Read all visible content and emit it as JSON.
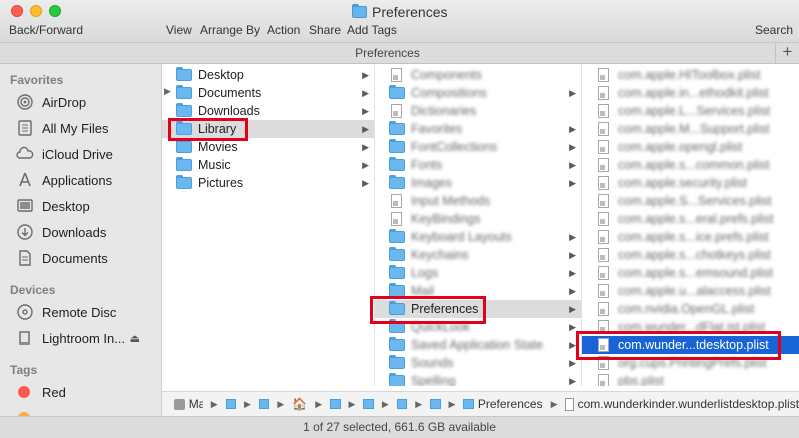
{
  "window": {
    "title": "Preferences"
  },
  "toolbar": {
    "back_forward": "Back/Forward",
    "view": "View",
    "arrange_by": "Arrange By",
    "action": "Action",
    "share": "Share",
    "add_tags": "Add Tags",
    "search": "Search"
  },
  "path_header": {
    "title": "Preferences",
    "plus": "+"
  },
  "sidebar": {
    "favorites_heading": "Favorites",
    "favorites": [
      {
        "label": "AirDrop",
        "icon": "airdrop-icon"
      },
      {
        "label": "All My Files",
        "icon": "all-files-icon"
      },
      {
        "label": "iCloud Drive",
        "icon": "cloud-icon"
      },
      {
        "label": "Applications",
        "icon": "applications-icon"
      },
      {
        "label": "Desktop",
        "icon": "desktop-icon"
      },
      {
        "label": "Downloads",
        "icon": "downloads-icon"
      },
      {
        "label": "Documents",
        "icon": "documents-icon"
      }
    ],
    "devices_heading": "Devices",
    "devices": [
      {
        "label": "Remote Disc",
        "icon": "disc-icon"
      },
      {
        "label": "Lightroom In...",
        "icon": "drive-icon"
      }
    ],
    "tags_heading": "Tags",
    "tags": [
      {
        "label": "Red",
        "color": "#fc5753"
      }
    ]
  },
  "column1": {
    "items": [
      {
        "label": "Desktop"
      },
      {
        "label": "Documents"
      },
      {
        "label": "Downloads"
      },
      {
        "label": "Library"
      },
      {
        "label": "Movies"
      },
      {
        "label": "Music"
      },
      {
        "label": "Pictures"
      }
    ]
  },
  "column2": {
    "items": [
      {
        "label": "Components"
      },
      {
        "label": "Compositions"
      },
      {
        "label": "Dictionaries"
      },
      {
        "label": "Favorites"
      },
      {
        "label": "FontCollections"
      },
      {
        "label": "Fonts"
      },
      {
        "label": "Images"
      },
      {
        "label": "Input Methods"
      },
      {
        "label": "KeyBindings"
      },
      {
        "label": "Keyboard Layouts"
      },
      {
        "label": "Keychains"
      },
      {
        "label": "Logs"
      },
      {
        "label": "Mail"
      },
      {
        "label": "Preferences"
      },
      {
        "label": "QuickLook"
      },
      {
        "label": "Saved Application State"
      },
      {
        "label": "Sounds"
      },
      {
        "label": "Spelling"
      }
    ]
  },
  "column3": {
    "items": [
      {
        "label": "com.apple.HIToolbox.plist"
      },
      {
        "label": "com.apple.in...ethodkit.plist"
      },
      {
        "label": "com.apple.L...Services.plist"
      },
      {
        "label": "com.apple.M...Support.plist"
      },
      {
        "label": "com.apple.opengl.plist"
      },
      {
        "label": "com.apple.s...common.plist"
      },
      {
        "label": "com.apple.security.plist"
      },
      {
        "label": "com.apple.S...Services.plist"
      },
      {
        "label": "com.apple.s...eral.prefs.plist"
      },
      {
        "label": "com.apple.s...ice.prefs.plist"
      },
      {
        "label": "com.apple.s...chotkeys.plist"
      },
      {
        "label": "com.apple.s...emsound.plist"
      },
      {
        "label": "com.apple.u...alaccess.plist"
      },
      {
        "label": "com.nvidia.OpenGL.plist"
      },
      {
        "label": "com.wunder...dFlat.ist.plist"
      },
      {
        "label": "com.wunder...tdesktop.plist"
      },
      {
        "label": "org.cups.PrintingPrefs.plist"
      },
      {
        "label": "pbs.plist"
      }
    ]
  },
  "pathbar": {
    "root": "Mac",
    "preferences": "Preferences",
    "file": "com.wunderkinder.wunderlistdesktop.plist"
  },
  "status": {
    "text": "1 of 27 selected, 661.6 GB available"
  }
}
